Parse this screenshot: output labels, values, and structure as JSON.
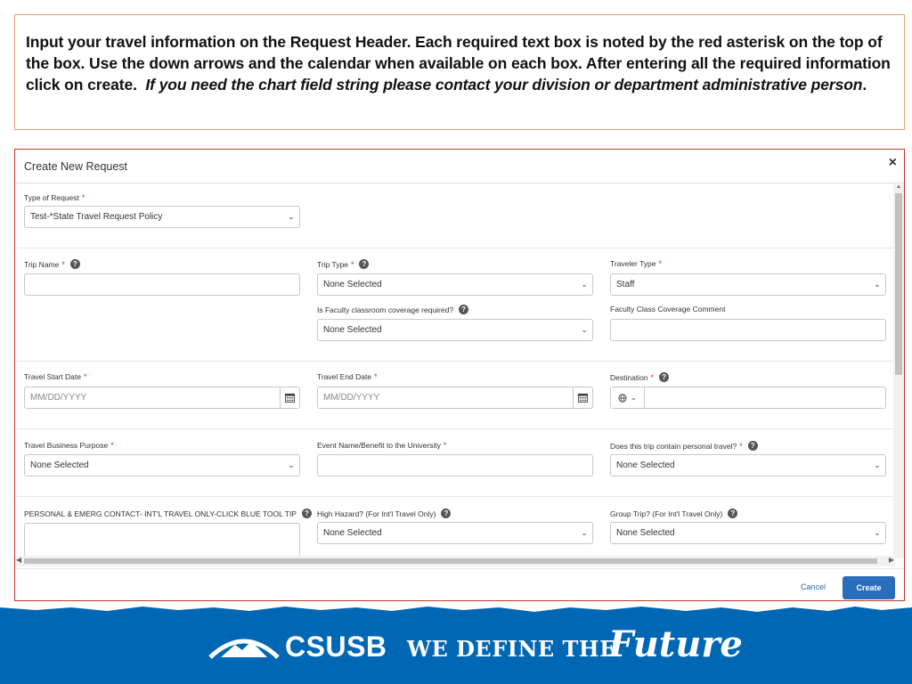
{
  "instructions": {
    "text": "Input your travel information on the Request Header. Each required text box is noted by the red asterisk on the top of the box.  Use the down arrows and the calendar when available on each box. After entering all the required information click on create.",
    "italic_text": "If you need the chart field string please contact your division or department administrative person",
    "end_punct": "."
  },
  "modal": {
    "title": "Create New Request",
    "close": "×",
    "fields": {
      "request_type": {
        "label": "Type of Request",
        "value": "Test-*State Travel Request Policy"
      },
      "trip_name": {
        "label": "Trip Name",
        "value": ""
      },
      "trip_type": {
        "label": "Trip Type",
        "value": "None Selected"
      },
      "traveler_type": {
        "label": "Traveler Type",
        "value": "Staff"
      },
      "faculty_coverage": {
        "label": "Is Faculty classroom coverage required?",
        "value": "None Selected"
      },
      "faculty_comment": {
        "label": "Faculty Class Coverage Comment",
        "value": ""
      },
      "start_date": {
        "label": "Travel Start Date",
        "placeholder": "MM/DD/YYYY"
      },
      "end_date": {
        "label": "Travel End Date",
        "placeholder": "MM/DD/YYYY"
      },
      "destination": {
        "label": "Destination",
        "value": ""
      },
      "business_purpose": {
        "label": "Travel Business Purpose",
        "value": "None Selected"
      },
      "event_name": {
        "label": "Event Name/Benefit to the University",
        "value": ""
      },
      "personal_travel": {
        "label": "Does this trip contain personal travel?",
        "value": "None Selected"
      },
      "emerg_contact": {
        "label": "PERSONAL & EMERG CONTACT- INT'L TRAVEL ONLY-CLICK BLUE TOOL TIP",
        "value": ""
      },
      "high_hazard": {
        "label": "High Hazard? (For Int'l Travel Only)",
        "value": "None Selected"
      },
      "group_trip": {
        "label": "Group Trip? (For Int'l Travel Only)",
        "value": "None Selected"
      }
    },
    "required_mark": "*",
    "help_glyph": "?",
    "buttons": {
      "cancel": "Cancel",
      "create": "Create"
    }
  },
  "banner": {
    "logo_text": "CSUSB",
    "tagline": "WE DEFINE THE",
    "tagline_script": "Future",
    "bg_color": "#0067b4"
  },
  "colors": {
    "accent": "#2a6ebb",
    "required": "#c0392b",
    "frame": "#c0392b",
    "instruction_border": "#e2a37a"
  },
  "icons": [
    "close-icon",
    "help-icon",
    "chevron-down-icon",
    "calendar-icon",
    "globe-icon",
    "mountain-logo-icon"
  ]
}
